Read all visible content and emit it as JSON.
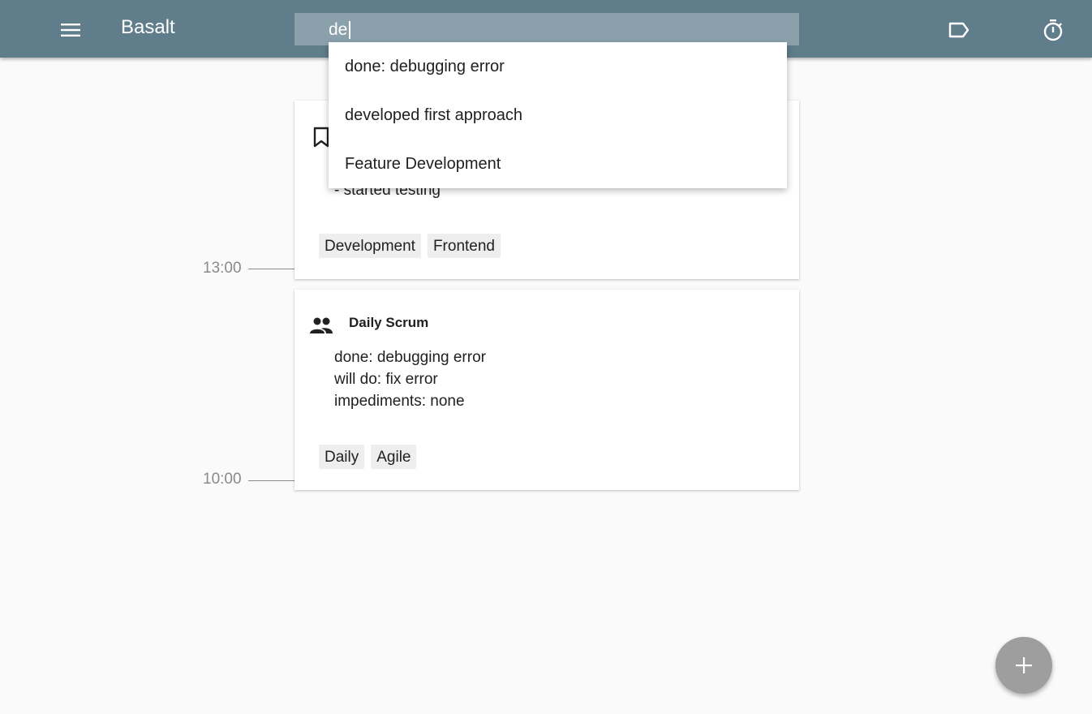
{
  "header": {
    "app_title": "Basalt",
    "menu_icon": "menu-icon",
    "label_icon": "label-icon",
    "timer_icon": "timer-icon",
    "background_color": "#607d8b"
  },
  "search": {
    "value": "de",
    "suggestions": [
      {
        "label": "done: debugging error"
      },
      {
        "label": "developed first approach"
      },
      {
        "label": "Feature Development"
      }
    ]
  },
  "timeline": {
    "time_labels": [
      "13:00",
      "10:00"
    ]
  },
  "entries": [
    {
      "icon": "bookmark-icon",
      "title": "",
      "visible_body_line": "- started testing",
      "tags": [
        "Development",
        "Frontend"
      ]
    },
    {
      "icon": "people-icon",
      "title": "Daily Scrum",
      "body_lines": [
        "done: debugging error",
        "will do: fix error",
        "impediments: none"
      ],
      "tags": [
        "Daily",
        "Agile"
      ]
    }
  ],
  "fab": {
    "icon": "plus-icon",
    "color": "#9e9e9e"
  }
}
